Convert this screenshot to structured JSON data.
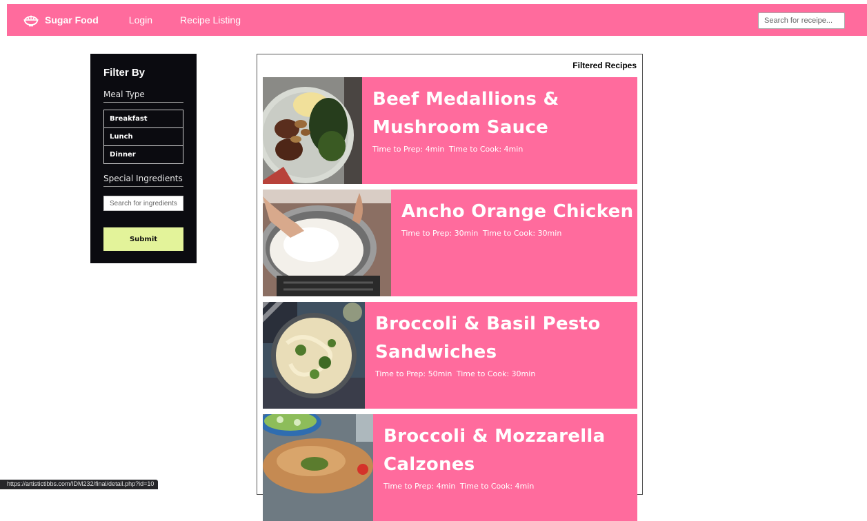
{
  "navbar": {
    "brand": "Sugar Food",
    "login": "Login",
    "recipe_listing": "Recipe Listing",
    "search_placeholder": "Search for receipe..."
  },
  "filter": {
    "title": "Filter By",
    "meal_type_label": "Meal Type",
    "meal_types": [
      "Breakfast",
      "Lunch",
      "Dinner"
    ],
    "special_ingredients_label": "Special Ingredients",
    "ingredients_placeholder": "Search for ingredients",
    "submit_label": "Submit"
  },
  "results": {
    "title": "Filtered Recipes",
    "recipes": [
      {
        "title_line1": "Beef Medallions &",
        "title_line2": "Mushroom Sauce",
        "prep": "Time to Prep: 4min",
        "cook": "Time to Cook: 4min"
      },
      {
        "title_line1": "Ancho Orange Chicken",
        "title_line2": "",
        "prep": "Time to Prep: 30min",
        "cook": "Time to Cook: 30min"
      },
      {
        "title_line1": "Broccoli & Basil Pesto",
        "title_line2": "Sandwiches",
        "prep": "Time to Prep: 50min",
        "cook": "Time to Cook: 30min"
      },
      {
        "title_line1": "Broccoli & Mozzarella",
        "title_line2": "Calzones",
        "prep": "Time to Prep: 4min",
        "cook": "Time to Cook: 4min"
      }
    ]
  },
  "status_url": "https://artistictibbs.com/IDM232/final/detail.php?id=10",
  "colors": {
    "navbar": "#ff6b9d",
    "card": "#ff6b9d",
    "sidebar": "#0b0b10",
    "submit": "#e3f39a"
  }
}
